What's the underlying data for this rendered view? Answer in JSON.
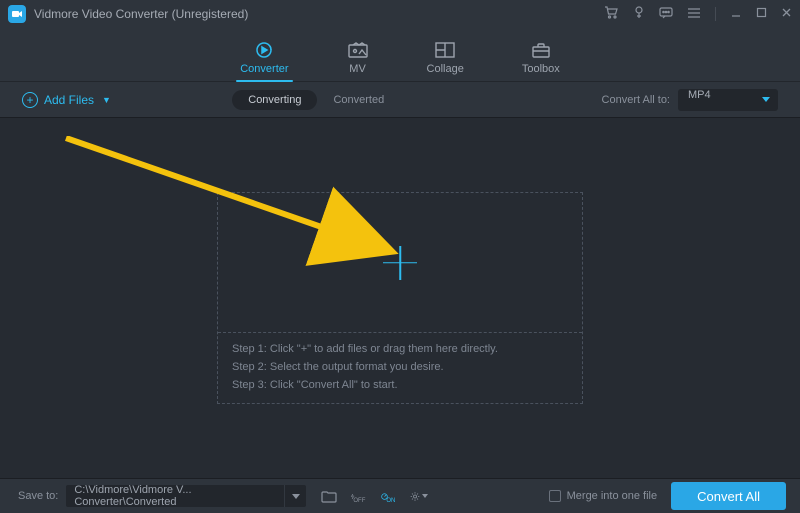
{
  "title": "Vidmore Video Converter (Unregistered)",
  "tabs": [
    {
      "label": "Converter"
    },
    {
      "label": "MV"
    },
    {
      "label": "Collage"
    },
    {
      "label": "Toolbox"
    }
  ],
  "toolbar": {
    "add_files": "Add Files",
    "subtabs": [
      {
        "label": "Converting"
      },
      {
        "label": "Converted"
      }
    ],
    "convert_all_to_label": "Convert All to:",
    "format_value": "MP4"
  },
  "dropzone": {
    "steps": [
      "Step 1: Click \"+\" to add files or drag them here directly.",
      "Step 2: Select the output format you desire.",
      "Step 3: Click \"Convert All\" to start."
    ]
  },
  "footer": {
    "save_to_label": "Save to:",
    "path": "C:\\Vidmore\\Vidmore V... Converter\\Converted",
    "merge_label": "Merge into one file",
    "convert_btn": "Convert All"
  }
}
